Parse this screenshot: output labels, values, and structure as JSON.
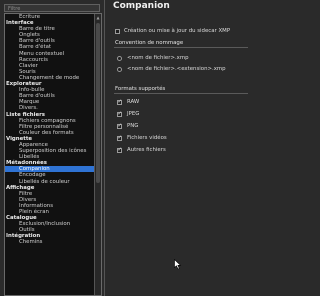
{
  "filter": {
    "placeholder": "Filtre"
  },
  "tree": [
    {
      "type": "leaf",
      "label": "Ecriture"
    },
    {
      "type": "group",
      "label": "Interface"
    },
    {
      "type": "leaf",
      "label": "Barre de titre"
    },
    {
      "type": "leaf",
      "label": "Onglets"
    },
    {
      "type": "leaf",
      "label": "Barre d'outils"
    },
    {
      "type": "leaf",
      "label": "Barre d'état"
    },
    {
      "type": "leaf",
      "label": "Menu contextuel"
    },
    {
      "type": "leaf",
      "label": "Raccourcis"
    },
    {
      "type": "leaf",
      "label": "Clavier"
    },
    {
      "type": "leaf",
      "label": "Souris"
    },
    {
      "type": "leaf",
      "label": "Changement de mode"
    },
    {
      "type": "group",
      "label": "Explorateur"
    },
    {
      "type": "leaf",
      "label": "Info-bulle"
    },
    {
      "type": "leaf",
      "label": "Barre d'outils"
    },
    {
      "type": "leaf",
      "label": "Marque"
    },
    {
      "type": "leaf",
      "label": "Divers."
    },
    {
      "type": "group",
      "label": "Liste fichiers"
    },
    {
      "type": "leaf",
      "label": "Fichiers compagnons"
    },
    {
      "type": "leaf",
      "label": "Filtre personnalisé"
    },
    {
      "type": "leaf",
      "label": "Couleur des formats"
    },
    {
      "type": "group",
      "label": "Vignette"
    },
    {
      "type": "leaf",
      "label": "Apparence"
    },
    {
      "type": "leaf",
      "label": "Superposition des icônes"
    },
    {
      "type": "leaf",
      "label": "Libellés"
    },
    {
      "type": "group",
      "label": "Métadonnées"
    },
    {
      "type": "leaf",
      "label": "Companion",
      "selected": true
    },
    {
      "type": "leaf",
      "label": "Encodage"
    },
    {
      "type": "leaf",
      "label": "Libellés de couleur"
    },
    {
      "type": "group",
      "label": "Affichage"
    },
    {
      "type": "leaf",
      "label": "Filtre"
    },
    {
      "type": "leaf",
      "label": "Divers"
    },
    {
      "type": "leaf",
      "label": "Informations"
    },
    {
      "type": "leaf",
      "label": "Plein écran"
    },
    {
      "type": "group",
      "label": "Catalogue"
    },
    {
      "type": "leaf",
      "label": "Exclusion/Inclusion"
    },
    {
      "type": "leaf",
      "label": "Outils"
    },
    {
      "type": "group",
      "label": "Intégration"
    },
    {
      "type": "leaf",
      "label": "Chemins"
    }
  ],
  "page": {
    "title": "Companion",
    "create_update_label": "Création ou mise à jour du sidecar XMP",
    "create_update_checked": false,
    "naming_header": "Convention de nommage",
    "naming_options": [
      {
        "label": "<nom de fichier>.xmp",
        "selected": false
      },
      {
        "label": "<nom de fichier>.<extension>.xmp",
        "selected": false
      }
    ],
    "formats_header": "Formats supportés",
    "formats": [
      {
        "label": "RAW",
        "checked": true
      },
      {
        "label": "JPEG",
        "checked": true
      },
      {
        "label": "PNG",
        "checked": true
      },
      {
        "label": "Fichiers vidéos",
        "checked": true
      },
      {
        "label": "Autres fichiers",
        "checked": true
      }
    ]
  },
  "icons": {
    "scroll_up": "triangle-up-icon",
    "cursor": "mouse-pointer-icon"
  },
  "colors": {
    "selection": "#2f73d4",
    "background": "#2a2a2a",
    "tree_background": "#111111"
  }
}
